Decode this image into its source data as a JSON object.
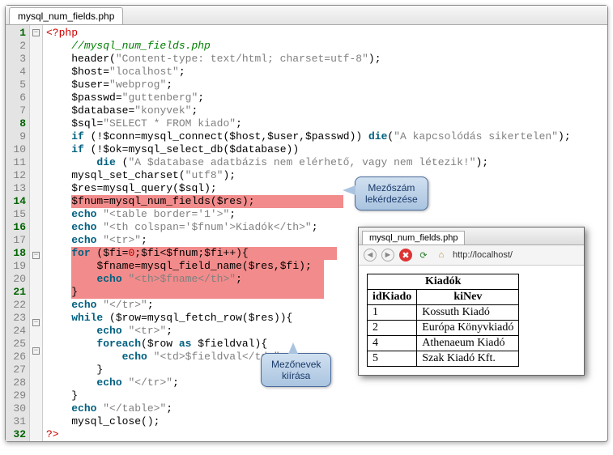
{
  "tab": {
    "title": "mysql_num_fields.php"
  },
  "lines": [
    {
      "n": 1,
      "hl": true,
      "html": "<span class='c-tag'>&lt;?php</span>"
    },
    {
      "n": 2,
      "hl": false,
      "html": "    <span class='c-comm'>//mysql_num_fields.php</span>"
    },
    {
      "n": 3,
      "hl": false,
      "html": "    <span class='c-fn'>header</span>(<span class='c-str'>\"Content-type: text/html; charset=utf-8\"</span>);"
    },
    {
      "n": 4,
      "hl": false,
      "html": "    <span class='c-var'>$host</span>=<span class='c-str'>\"localhost\"</span>;"
    },
    {
      "n": 5,
      "hl": false,
      "html": "    <span class='c-var'>$user</span>=<span class='c-str'>\"webprog\"</span>;"
    },
    {
      "n": 6,
      "hl": false,
      "html": "    <span class='c-var'>$passwd</span>=<span class='c-str'>\"guttenberg\"</span>;"
    },
    {
      "n": 7,
      "hl": false,
      "html": "    <span class='c-var'>$database</span>=<span class='c-str'>\"konyvek\"</span>;"
    },
    {
      "n": 8,
      "hl": true,
      "html": "    <span class='c-var'>$sql</span>=<span class='c-str'>\"SELECT * FROM kiado\"</span>;"
    },
    {
      "n": 9,
      "hl": false,
      "html": "    <span class='c-kw'>if</span> (!<span class='c-var'>$conn</span>=<span class='c-fn'>mysql_connect</span>(<span class='c-var'>$host</span>,<span class='c-var'>$user</span>,<span class='c-var'>$passwd</span>)) <span class='c-kw'>die</span>(<span class='c-str'>\"A kapcsolódás sikertelen\"</span>);"
    },
    {
      "n": 10,
      "hl": false,
      "html": "    <span class='c-kw'>if</span> (!<span class='c-var'>$ok</span>=<span class='c-fn'>mysql_select_db</span>(<span class='c-var'>$database</span>))"
    },
    {
      "n": 11,
      "hl": false,
      "html": "        <span class='c-kw'>die</span> (<span class='c-str'>\"A $database adatbázis nem elérhető, vagy nem létezik!\"</span>);"
    },
    {
      "n": 12,
      "hl": false,
      "html": "    <span class='c-fn'>mysql_set_charset</span>(<span class='c-str'>\"utf8\"</span>);"
    },
    {
      "n": 13,
      "hl": false,
      "html": "    <span class='c-var'>$res</span>=<span class='c-fn'>mysql_query</span>(<span class='c-var'>$sql</span>);"
    },
    {
      "n": 14,
      "hl": true,
      "html": "    <span class='hl-line'><span class='c-var'>$fnum</span>=<span class='c-fn'>mysql_num_fields</span>(<span class='c-var'>$res</span>);&nbsp;&nbsp;&nbsp;&nbsp;&nbsp;&nbsp;&nbsp;&nbsp;&nbsp;&nbsp;&nbsp;&nbsp;&nbsp;&nbsp;</span>"
    },
    {
      "n": 15,
      "hl": false,
      "html": "    <span class='c-kw'>echo</span> <span class='c-str'>\"&lt;table border='1'&gt;\"</span>;"
    },
    {
      "n": 16,
      "hl": true,
      "html": "    <span class='c-kw'>echo</span> <span class='c-str'>\"&lt;th colspan='$fnum'&gt;Kiadók&lt;/th&gt;\"</span>;"
    },
    {
      "n": 17,
      "hl": false,
      "html": "    <span class='c-kw'>echo</span> <span class='c-str'>\"&lt;tr&gt;\"</span>;"
    },
    {
      "n": 18,
      "hl": true,
      "html": "    <span class='hl-line'><span class='c-kw'>for</span> (<span class='c-var'>$fi</span>=<span class='c-num'>0</span>;<span class='c-var'>$fi</span>&lt;<span class='c-var'>$fnum</span>;<span class='c-var'>$fi</span>++){&nbsp;&nbsp;&nbsp;&nbsp;&nbsp;&nbsp;&nbsp;&nbsp;&nbsp;&nbsp;&nbsp;&nbsp;&nbsp;&nbsp;</span>"
    },
    {
      "n": 19,
      "hl": false,
      "html": "    <span class='hl-line'>    <span class='c-var'>$fname</span>=<span class='c-fn'>mysql_field_name</span>(<span class='c-var'>$res</span>,<span class='c-var'>$fi</span>);&nbsp;&nbsp;</span>"
    },
    {
      "n": 20,
      "hl": false,
      "html": "    <span class='hl-line'>    <span class='c-kw'>echo</span> <span class='c-str'>\"&lt;th&gt;$fname&lt;/th&gt;\"</span>;&nbsp;&nbsp;&nbsp;&nbsp;&nbsp;&nbsp;&nbsp;&nbsp;&nbsp;&nbsp;&nbsp;&nbsp;&nbsp;</span>"
    },
    {
      "n": 21,
      "hl": true,
      "html": "    <span class='hl-line'>}&nbsp;&nbsp;&nbsp;&nbsp;&nbsp;&nbsp;&nbsp;&nbsp;&nbsp;&nbsp;&nbsp;&nbsp;&nbsp;&nbsp;&nbsp;&nbsp;&nbsp;&nbsp;&nbsp;&nbsp;&nbsp;&nbsp;&nbsp;&nbsp;&nbsp;&nbsp;&nbsp;&nbsp;&nbsp;&nbsp;&nbsp;&nbsp;&nbsp;&nbsp;&nbsp;&nbsp;&nbsp;&nbsp;&nbsp;</span>"
    },
    {
      "n": 22,
      "hl": false,
      "html": "    <span class='c-kw'>echo</span> <span class='c-str'>\"&lt;/tr&gt;\"</span>;"
    },
    {
      "n": 23,
      "hl": false,
      "html": "    <span class='c-kw'>while</span> (<span class='c-var'>$row</span>=<span class='c-fn'>mysql_fetch_row</span>(<span class='c-var'>$res</span>)){"
    },
    {
      "n": 24,
      "hl": false,
      "html": "        <span class='c-kw'>echo</span> <span class='c-str'>\"&lt;tr&gt;\"</span>;"
    },
    {
      "n": 25,
      "hl": false,
      "html": "        <span class='c-kw'>foreach</span>(<span class='c-var'>$row</span> <span class='c-kw'>as</span> <span class='c-var'>$fieldval</span>){"
    },
    {
      "n": 26,
      "hl": false,
      "html": "            <span class='c-kw'>echo</span> <span class='c-str'>\"&lt;td&gt;$fieldval&lt;/td&gt;\"</span>;"
    },
    {
      "n": 27,
      "hl": false,
      "html": "        }"
    },
    {
      "n": 28,
      "hl": false,
      "html": "        <span class='c-kw'>echo</span> <span class='c-str'>\"&lt;/tr&gt;\"</span>;"
    },
    {
      "n": 29,
      "hl": false,
      "html": "    }"
    },
    {
      "n": 30,
      "hl": false,
      "html": "    <span class='c-kw'>echo</span> <span class='c-str'>\"&lt;/table&gt;\"</span>;"
    },
    {
      "n": 31,
      "hl": false,
      "html": "    <span class='c-fn'>mysql_close</span>();"
    },
    {
      "n": 32,
      "hl": true,
      "html": "<span class='c-tag'>?&gt;</span>"
    }
  ],
  "callouts": {
    "c1": "Mezőszám\nlekérdezése",
    "c2": "Mezőnevek\nkiírása"
  },
  "preview": {
    "tab": "mysql_num_fields.php",
    "url": "http://localhost/",
    "table": {
      "title": "Kiadók",
      "headers": [
        "idKiado",
        "kiNev"
      ],
      "rows": [
        [
          "1",
          "Kossuth Kiadó"
        ],
        [
          "2",
          "Európa Könyvkiadó"
        ],
        [
          "4",
          "Athenaeum Kiadó"
        ],
        [
          "5",
          "Szak Kiadó Kft."
        ]
      ]
    }
  }
}
